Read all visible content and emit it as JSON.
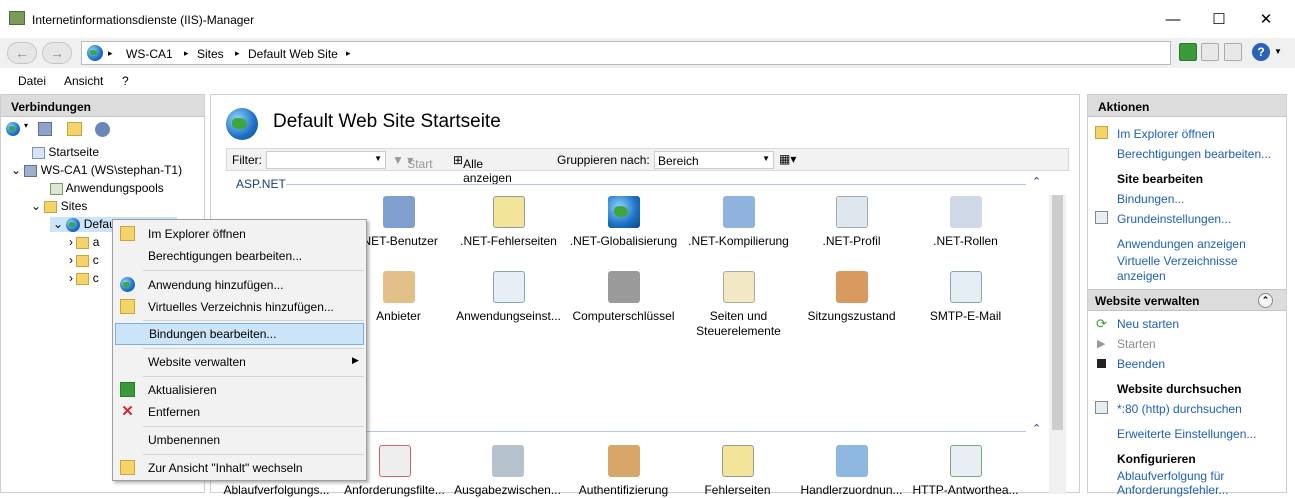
{
  "window": {
    "title": "Internetinformationsdienste (IIS)-Manager",
    "minimize": "—",
    "maximize": "☐",
    "close": "✕"
  },
  "navbar": {
    "breadcrumb": [
      "WS-CA1",
      "Sites",
      "Default Web Site"
    ],
    "separator": "▸",
    "help": "?"
  },
  "menu": [
    "Datei",
    "Ansicht",
    "?"
  ],
  "connections": {
    "title": "Verbindungen",
    "tree": {
      "start": "Startseite",
      "server": "WS-CA1 (WS\\stephan-T1)",
      "apppools": "Anwendungspools",
      "sites": "Sites",
      "site": "Default Web Site",
      "child1": "a",
      "child2": "c",
      "child3": "c"
    }
  },
  "main": {
    "title": "Default Web Site Startseite",
    "filter": {
      "label": "Filter:",
      "start": "Start",
      "show_all": "Alle anzeigen",
      "group_by": "Gruppieren nach:",
      "group_value": "Bereich"
    },
    "section": "ASP.NET",
    "features_row1": [
      ".NET-Benutzer",
      ".NET-Fehlerseiten",
      ".NET-Globalisierung",
      ".NET-Kompilierung",
      ".NET-Profil",
      ".NET-Rollen"
    ],
    "features_row2": [
      "Anbieter",
      "Anwendungseinst...",
      "Computerschlüssel",
      "Seiten und Steuerelemente",
      "Sitzungszustand",
      "SMTP-E-Mail"
    ],
    "features_row3": [
      "Ablaufverfolgungs...",
      "Anforderungsfilte...",
      "Ausgabezwischen...",
      "Authentifizierung",
      "Fehlerseiten",
      "Handlerzuordnun...",
      "HTTP-Antworthea..."
    ]
  },
  "actions": {
    "title": "Aktionen",
    "explore": "Im Explorer öffnen",
    "edit_permissions": "Berechtigungen bearbeiten...",
    "edit_site_title": "Site bearbeiten",
    "bindings": "Bindungen...",
    "basic_settings": "Grundeinstellungen...",
    "view_apps": "Anwendungen anzeigen",
    "view_vdirs": "Virtuelle Verzeichnisse anzeigen",
    "manage_title": "Website verwalten",
    "restart": "Neu starten",
    "start": "Starten",
    "stop": "Beenden",
    "browse_title": "Website durchsuchen",
    "browse_80": "*:80 (http) durchsuchen",
    "advanced": "Erweiterte Einstellungen...",
    "configure_title": "Konfigurieren",
    "tracing": "Ablaufverfolgung für Anforderungsfehler..."
  },
  "context_menu": [
    "Im Explorer öffnen",
    "Berechtigungen bearbeiten...",
    "Anwendung hinzufügen...",
    "Virtuelles Verzeichnis hinzufügen...",
    "Bindungen bearbeiten...",
    "Website verwalten",
    "Aktualisieren",
    "Entfernen",
    "Umbenennen",
    "Zur Ansicht \"Inhalt\" wechseln"
  ]
}
